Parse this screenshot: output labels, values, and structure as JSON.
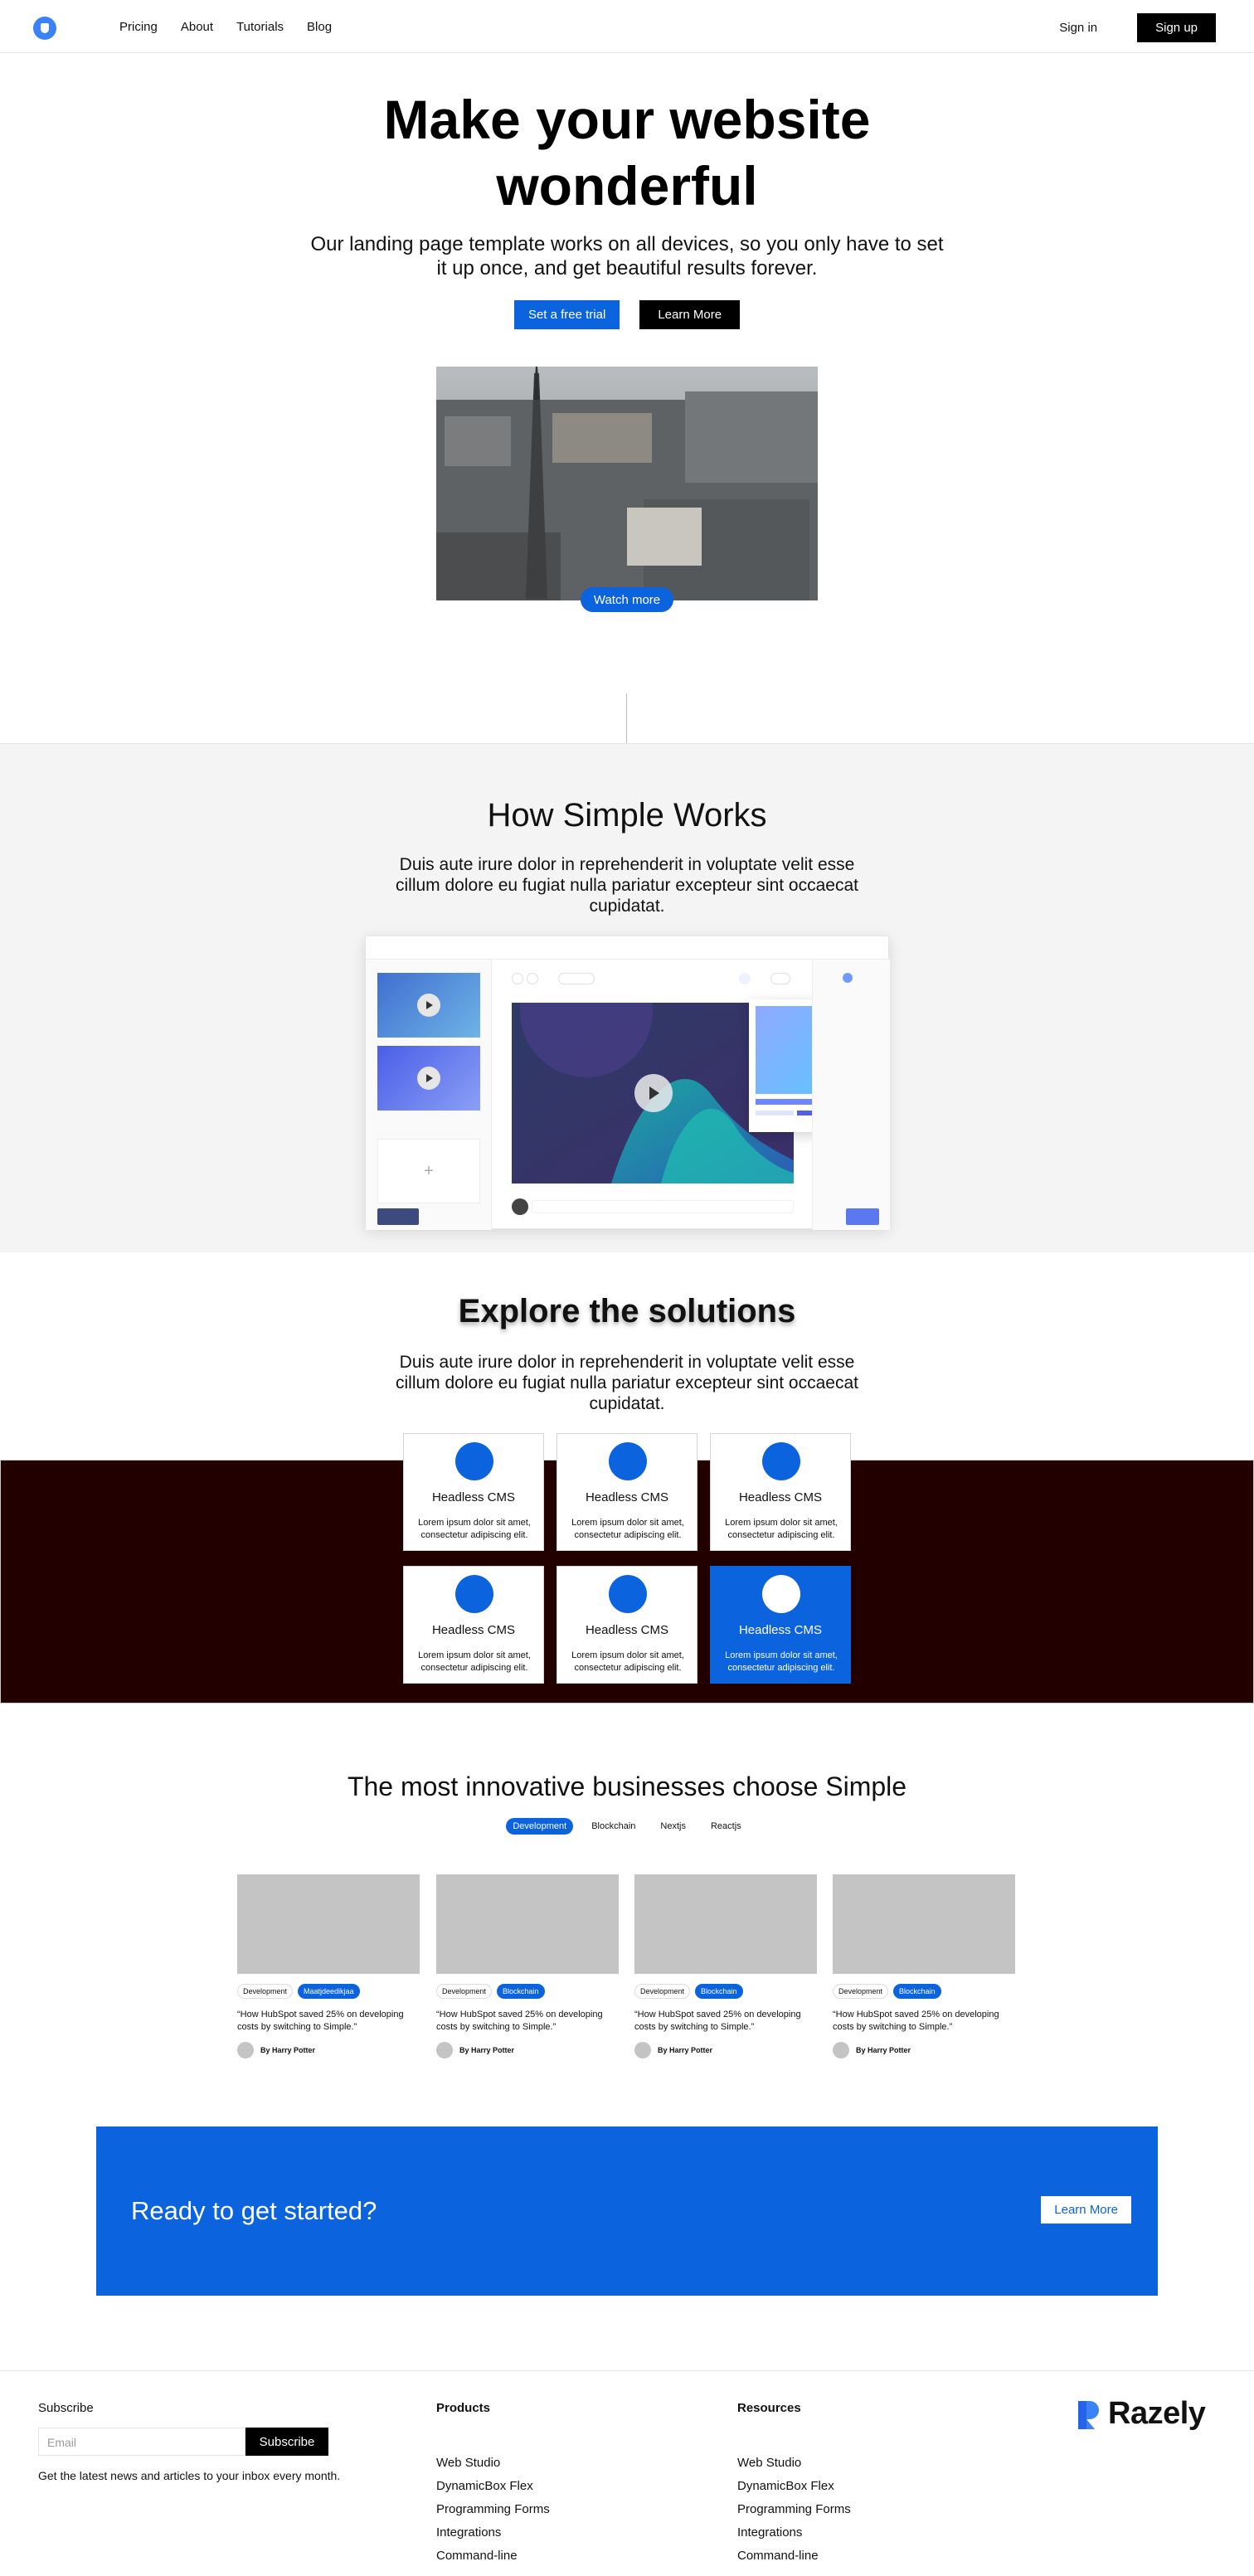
{
  "nav": {
    "links": [
      "Pricing",
      "About",
      "Tutorials",
      "Blog"
    ],
    "sign_in": "Sign in",
    "sign_up": "Sign up"
  },
  "hero": {
    "title_line1": "Make your website",
    "title_line2": "wonderful",
    "subtitle": "Our landing page template works on all devices, so you only have to set it up once, and get beautiful results forever.",
    "primary_cta": "Set a free trial",
    "secondary_cta": "Learn More",
    "watch_more": "Watch more"
  },
  "how": {
    "title": "How Simple Works",
    "subtitle": "Duis aute irure dolor in reprehenderit in voluptate velit esse cillum dolore eu fugiat nulla pariatur excepteur sint occaecat cupidatat."
  },
  "explore": {
    "title": "Explore the solutions",
    "subtitle": "Duis aute irure dolor in reprehenderit in voluptate velit esse cillum dolore eu fugiat nulla pariatur excepteur sint occaecat cupidatat.",
    "cards": [
      {
        "title": "Headless CMS",
        "desc": "Lorem ipsum dolor sit amet, consectetur adipiscing elit."
      },
      {
        "title": "Headless CMS",
        "desc": "Lorem ipsum dolor sit amet, consectetur adipiscing elit."
      },
      {
        "title": "Headless CMS",
        "desc": "Lorem ipsum dolor sit amet, consectetur adipiscing elit."
      },
      {
        "title": "Headless CMS",
        "desc": "Lorem ipsum dolor sit amet, consectetur adipiscing elit."
      },
      {
        "title": "Headless CMS",
        "desc": "Lorem ipsum dolor sit amet, consectetur adipiscing elit."
      },
      {
        "title": "Headless CMS",
        "desc": "Lorem ipsum dolor sit amet, consectetur adipiscing elit."
      }
    ],
    "active_card": 5
  },
  "businesses": {
    "title": "The most innovative businesses choose Simple",
    "filters": [
      "Development",
      "Blockchain",
      "Nextjs",
      "Reactjs"
    ],
    "active_filter": 0,
    "cards": [
      {
        "tag1": "Development",
        "tag2": "Maatjdeedikjaa",
        "quote": "“How HubSpot saved 25% on developing costs by switching to Simple.”",
        "author": "By Harry Potter"
      },
      {
        "tag1": "Development",
        "tag2": "Blockchain",
        "quote": "“How HubSpot saved 25% on developing costs by switching to Simple.”",
        "author": "By Harry Potter"
      },
      {
        "tag1": "Development",
        "tag2": "Blockchain",
        "quote": "“How HubSpot saved 25% on developing costs by switching to Simple.”",
        "author": "By Harry Potter"
      },
      {
        "tag1": "Development",
        "tag2": "Blockchain",
        "quote": "“How HubSpot saved 25% on developing costs by switching to Simple.”",
        "author": "By Harry Potter"
      }
    ]
  },
  "cta": {
    "text": "Ready to get started?",
    "button": "Learn More"
  },
  "footer": {
    "subscribe_title": "Subscribe",
    "email_placeholder": "Email",
    "subscribe_button": "Subscribe",
    "note": "Get the latest news and articles to your inbox every month.",
    "products_title": "Products",
    "products": [
      "Web Studio",
      "DynamicBox Flex",
      "Programming Forms",
      "Integrations",
      "Command-line"
    ],
    "resources_title": "Resources",
    "resources": [
      "Web Studio",
      "DynamicBox Flex",
      "Programming Forms",
      "Integrations",
      "Command-line"
    ],
    "brand": "Razely"
  },
  "colors": {
    "accent": "#0b63de",
    "dark_band": "#230000",
    "light_section": "#f4f4f4"
  }
}
